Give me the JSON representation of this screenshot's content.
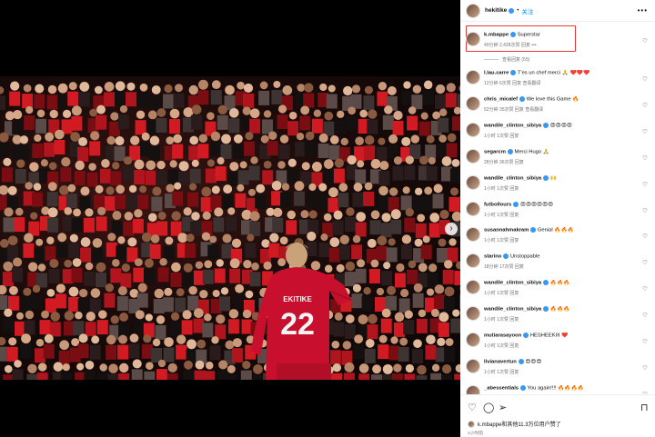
{
  "post": {
    "author": "hekitike",
    "follow_label": "关注",
    "more_label": "•••"
  },
  "media": {
    "player_number": "22",
    "player_name": "EKITIKE",
    "next_label": "›"
  },
  "highlight_comment": {
    "user": "k.mbappe",
    "text": "Superstar",
    "meta": "49分钟  2,428次赞  回复  •••",
    "replies_label": "查看回复 (55)"
  },
  "comments": [
    {
      "user": "l.lau.carre",
      "text": "T'es un chef merci 🙏 ❤️❤️❤️",
      "meta": "12分钟  6次赞  回复  查看翻译"
    },
    {
      "user": "chris_micalef",
      "text": "We love this Game 🔥",
      "meta": "52分钟  35次赞  回复  查看翻译"
    },
    {
      "user": "wandile_clinton_sibiya",
      "text": "😍😍😍😍",
      "meta": "1小时  1次赞  回复"
    },
    {
      "user": "segarcm",
      "text": "Merci Hugo 🙏",
      "meta": "28分钟  36次赞  回复"
    },
    {
      "user": "wandile_clinton_sibiya",
      "text": "🙌",
      "meta": "1小时  1次赞  回复"
    },
    {
      "user": "futbollours",
      "text": "😍😍😍😍😍😍",
      "meta": "1小时  1次赞  回复"
    },
    {
      "user": "susannahmakram",
      "text": "Genial 🔥🔥🔥",
      "meta": "1小时  1次赞  回复"
    },
    {
      "user": "starino",
      "text": "Unstoppable",
      "meta": "18分钟  17次赞  回复"
    },
    {
      "user": "wandile_clinton_sibiya",
      "text": "🔥🔥🔥",
      "meta": "1小时  1次赞  回复"
    },
    {
      "user": "wandile_clinton_sibiya",
      "text": "🔥🔥🔥",
      "meta": "1小时  1次赞  回复"
    },
    {
      "user": "mutiarasayoon",
      "text": "HESHEEKIII ❤️",
      "meta": "1小时  1次赞  回复"
    },
    {
      "user": "livianavertun",
      "text": "😍😍😍",
      "meta": "1小时  1次赞  回复"
    },
    {
      "user": "_abessentials",
      "text": "You again!!!! 🔥🔥🔥🔥",
      "meta": ""
    }
  ],
  "footer": {
    "likes_text": "k.mbappe和其他11.3万位用户赞了",
    "time": "1小时前",
    "icons": [
      "heart-icon",
      "comment-icon",
      "share-icon",
      "bookmark-icon"
    ]
  },
  "colors": {
    "highlight_border": "#e53935",
    "verified": "#3897f0",
    "follow": "#0095f6",
    "jersey": "#c8102e"
  }
}
